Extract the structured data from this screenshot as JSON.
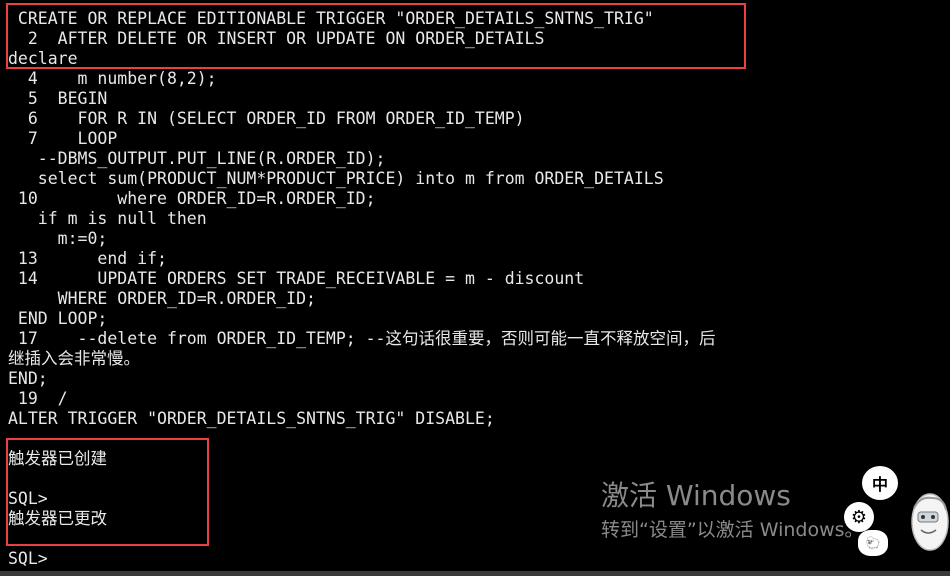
{
  "console": {
    "lines": [
      " CREATE OR REPLACE EDITIONABLE TRIGGER \"ORDER_DETAILS_SNTNS_TRIG\"",
      "  2  AFTER DELETE OR INSERT OR UPDATE ON ORDER_DETAILS",
      "declare",
      "  4    m number(8,2);",
      "  5  BEGIN",
      "  6    FOR R IN (SELECT ORDER_ID FROM ORDER_ID_TEMP)",
      "  7    LOOP",
      "   --DBMS_OUTPUT.PUT_LINE(R.ORDER_ID);",
      "   select sum(PRODUCT_NUM*PRODUCT_PRICE) into m from ORDER_DETAILS",
      " 10        where ORDER_ID=R.ORDER_ID;",
      "   if m is null then",
      "     m:=0;",
      " 13      end if;",
      " 14      UPDATE ORDERS SET TRADE_RECEIVABLE = m - discount",
      "     WHERE ORDER_ID=R.ORDER_ID;",
      " END LOOP;",
      " 17    --delete from ORDER_ID_TEMP; --这句话很重要，否则可能一直不释放空间，后",
      "继插入会非常慢。",
      "END;",
      " 19  /",
      "ALTER TRIGGER \"ORDER_DETAILS_SNTNS_TRIG\" DISABLE;",
      "",
      "触发器已创建",
      "",
      "SQL>",
      "触发器已更改",
      "",
      "SQL>"
    ]
  },
  "watermark": {
    "title": "激活 Windows",
    "subtitle": "转到“设置”以激活 Windows。"
  },
  "ime": {
    "lang_label": "中",
    "gear_icon": "⚙",
    "sheep_icon": "🐑"
  },
  "colors": {
    "background": "#000000",
    "text": "#e8e8e8",
    "annotation": "#e8413f",
    "watermark": "#8a8a8a"
  }
}
